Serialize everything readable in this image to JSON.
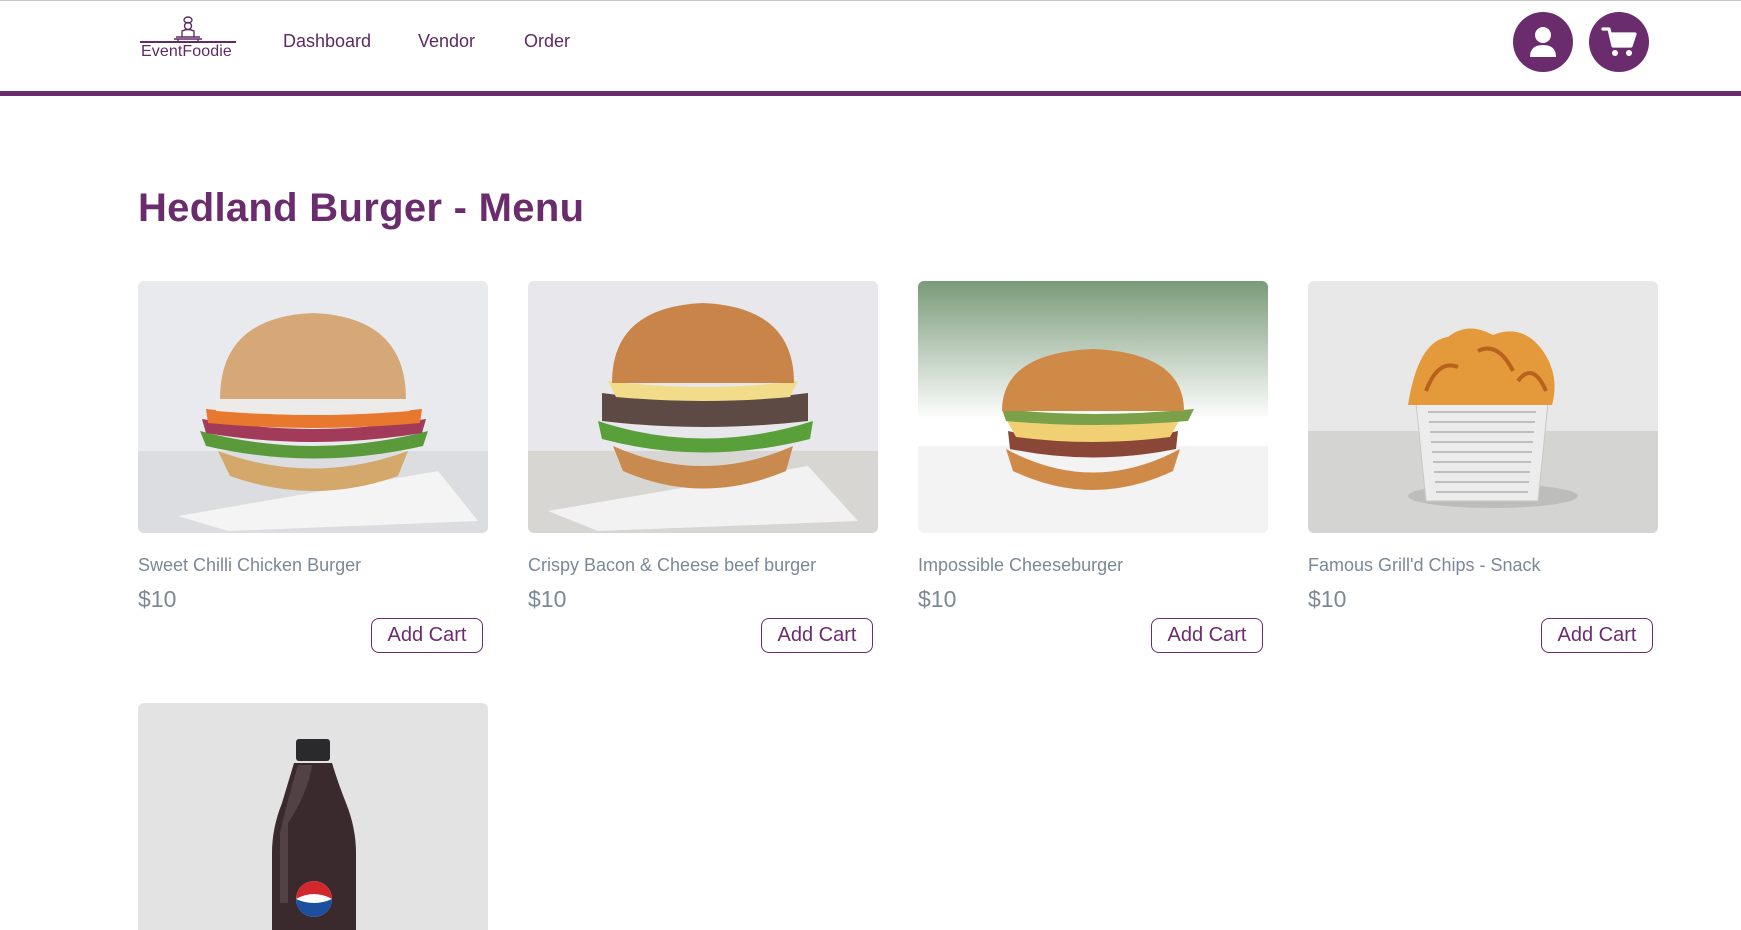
{
  "brand": {
    "name": "EventFoodie",
    "color": "#6b2c6e"
  },
  "nav": {
    "links": [
      "Dashboard",
      "Vendor",
      "Order"
    ],
    "icons": [
      "user-icon",
      "cart-icon"
    ]
  },
  "page": {
    "title": "Hedland Burger - Menu"
  },
  "menu": {
    "items": [
      {
        "name": "Sweet Chilli Chicken Burger",
        "price": "$10",
        "button": "Add Cart"
      },
      {
        "name": "Crispy Bacon & Cheese beef burger",
        "price": "$10",
        "button": "Add Cart"
      },
      {
        "name": "Impossible Cheeseburger",
        "price": "$10",
        "button": "Add Cart"
      },
      {
        "name": "Famous Grill'd Chips - Snack",
        "price": "$10",
        "button": "Add Cart"
      },
      {
        "name": "",
        "price": "",
        "button": ""
      }
    ]
  }
}
